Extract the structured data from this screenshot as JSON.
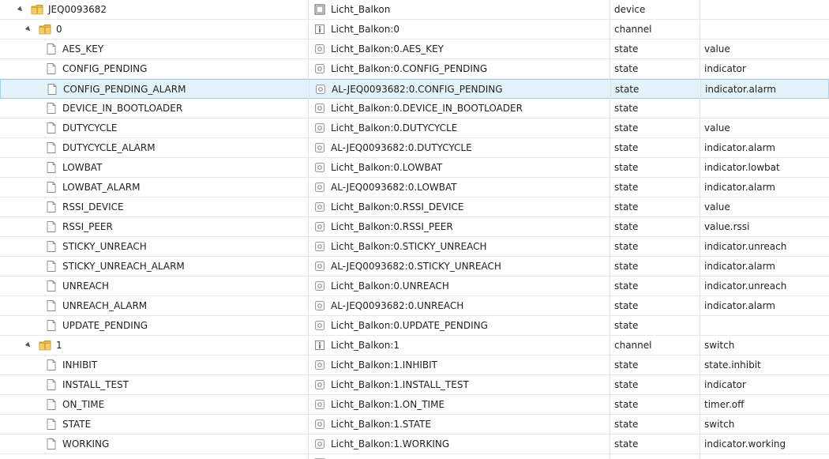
{
  "rows": [
    {
      "level": 0,
      "kind": "folder",
      "expanded": true,
      "name": "JEQ0093682",
      "id_name": "Licht_Balkon",
      "type_icon": "device-icon",
      "type": "device",
      "role": ""
    },
    {
      "level": 1,
      "kind": "folder",
      "expanded": true,
      "name": "0",
      "id_name": "Licht_Balkon:0",
      "type_icon": "channel-icon",
      "type": "channel",
      "role": ""
    },
    {
      "level": 2,
      "kind": "file",
      "name": "AES_KEY",
      "id_name": "Licht_Balkon:0.AES_KEY",
      "type_icon": "state-icon",
      "type": "state",
      "role": "value"
    },
    {
      "level": 2,
      "kind": "file",
      "name": "CONFIG_PENDING",
      "id_name": "Licht_Balkon:0.CONFIG_PENDING",
      "type_icon": "state-icon",
      "type": "state",
      "role": "indicator"
    },
    {
      "level": 2,
      "kind": "file",
      "name": "CONFIG_PENDING_ALARM",
      "id_name": "AL-JEQ0093682:0.CONFIG_PENDING",
      "type_icon": "state-icon",
      "type": "state",
      "role": "indicator.alarm",
      "selected": true
    },
    {
      "level": 2,
      "kind": "file",
      "name": "DEVICE_IN_BOOTLOADER",
      "id_name": "Licht_Balkon:0.DEVICE_IN_BOOTLOADER",
      "type_icon": "state-icon",
      "type": "state",
      "role": ""
    },
    {
      "level": 2,
      "kind": "file",
      "name": "DUTYCYCLE",
      "id_name": "Licht_Balkon:0.DUTYCYCLE",
      "type_icon": "state-icon",
      "type": "state",
      "role": "value"
    },
    {
      "level": 2,
      "kind": "file",
      "name": "DUTYCYCLE_ALARM",
      "id_name": "AL-JEQ0093682:0.DUTYCYCLE",
      "type_icon": "state-icon",
      "type": "state",
      "role": "indicator.alarm"
    },
    {
      "level": 2,
      "kind": "file",
      "name": "LOWBAT",
      "id_name": "Licht_Balkon:0.LOWBAT",
      "type_icon": "state-icon",
      "type": "state",
      "role": "indicator.lowbat"
    },
    {
      "level": 2,
      "kind": "file",
      "name": "LOWBAT_ALARM",
      "id_name": "AL-JEQ0093682:0.LOWBAT",
      "type_icon": "state-icon",
      "type": "state",
      "role": "indicator.alarm"
    },
    {
      "level": 2,
      "kind": "file",
      "name": "RSSI_DEVICE",
      "id_name": "Licht_Balkon:0.RSSI_DEVICE",
      "type_icon": "state-icon",
      "type": "state",
      "role": "value"
    },
    {
      "level": 2,
      "kind": "file",
      "name": "RSSI_PEER",
      "id_name": "Licht_Balkon:0.RSSI_PEER",
      "type_icon": "state-icon",
      "type": "state",
      "role": "value.rssi"
    },
    {
      "level": 2,
      "kind": "file",
      "name": "STICKY_UNREACH",
      "id_name": "Licht_Balkon:0.STICKY_UNREACH",
      "type_icon": "state-icon",
      "type": "state",
      "role": "indicator.unreach"
    },
    {
      "level": 2,
      "kind": "file",
      "name": "STICKY_UNREACH_ALARM",
      "id_name": "AL-JEQ0093682:0.STICKY_UNREACH",
      "type_icon": "state-icon",
      "type": "state",
      "role": "indicator.alarm"
    },
    {
      "level": 2,
      "kind": "file",
      "name": "UNREACH",
      "id_name": "Licht_Balkon:0.UNREACH",
      "type_icon": "state-icon",
      "type": "state",
      "role": "indicator.unreach"
    },
    {
      "level": 2,
      "kind": "file",
      "name": "UNREACH_ALARM",
      "id_name": "AL-JEQ0093682:0.UNREACH",
      "type_icon": "state-icon",
      "type": "state",
      "role": "indicator.alarm"
    },
    {
      "level": 2,
      "kind": "file",
      "name": "UPDATE_PENDING",
      "id_name": "Licht_Balkon:0.UPDATE_PENDING",
      "type_icon": "state-icon",
      "type": "state",
      "role": ""
    },
    {
      "level": 1,
      "kind": "folder",
      "expanded": true,
      "name": "1",
      "id_name": "Licht_Balkon:1",
      "type_icon": "channel-icon",
      "type": "channel",
      "role": "switch"
    },
    {
      "level": 2,
      "kind": "file",
      "name": "INHIBIT",
      "id_name": "Licht_Balkon:1.INHIBIT",
      "type_icon": "state-icon",
      "type": "state",
      "role": "state.inhibit"
    },
    {
      "level": 2,
      "kind": "file",
      "name": "INSTALL_TEST",
      "id_name": "Licht_Balkon:1.INSTALL_TEST",
      "type_icon": "state-icon",
      "type": "state",
      "role": "indicator"
    },
    {
      "level": 2,
      "kind": "file",
      "name": "ON_TIME",
      "id_name": "Licht_Balkon:1.ON_TIME",
      "type_icon": "state-icon",
      "type": "state",
      "role": "timer.off"
    },
    {
      "level": 2,
      "kind": "file",
      "name": "STATE",
      "id_name": "Licht_Balkon:1.STATE",
      "type_icon": "state-icon",
      "type": "state",
      "role": "switch"
    },
    {
      "level": 2,
      "kind": "file",
      "name": "WORKING",
      "id_name": "Licht_Balkon:1.WORKING",
      "type_icon": "state-icon",
      "type": "state",
      "role": "indicator.working"
    }
  ],
  "clipped_row": {
    "kind": "folder",
    "type_icon": "device-icon"
  }
}
